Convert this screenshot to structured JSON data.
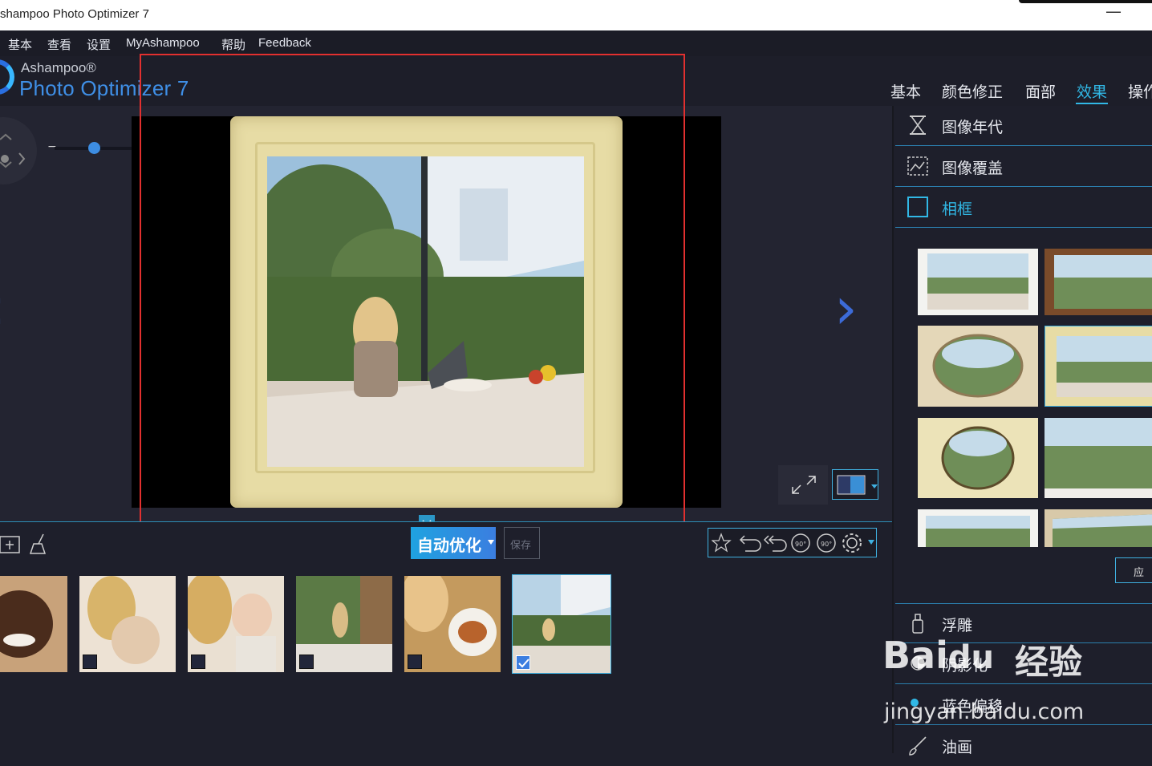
{
  "window": {
    "title": "shampoo Photo Optimizer 7",
    "minimize_glyph": "—"
  },
  "menu": [
    "基本",
    "查看",
    "设置",
    "MyAshampoo",
    "帮助",
    "Feedback"
  ],
  "logo": {
    "brand": "Ashampoo®",
    "product": "Photo Optimizer 7"
  },
  "tabs": [
    {
      "label": "基本",
      "active": false
    },
    {
      "label": "颜色修正",
      "active": false
    },
    {
      "label": "面部",
      "active": false
    },
    {
      "label": "效果",
      "active": true
    },
    {
      "label": "操作",
      "active": false
    }
  ],
  "zoom": {
    "minus": "−",
    "plus": "+",
    "level": 0.35
  },
  "toolbar": {
    "auto_optimize_label": "自动优化",
    "save_label": "保存",
    "tool_icons": [
      "magic-stars-icon",
      "undo-icon",
      "undo-all-icon",
      "rotate-left-90-icon",
      "rotate-right-90-icon",
      "settings-icon"
    ],
    "rotate_left_text": "90°",
    "rotate_right_text": "90°"
  },
  "filmstrip": [
    {
      "name": "boy-portrait",
      "checked": false
    },
    {
      "name": "mother-baby-1",
      "checked": false
    },
    {
      "name": "mother-baby-2",
      "checked": false
    },
    {
      "name": "kitchen-family",
      "checked": false
    },
    {
      "name": "breakfast-table",
      "checked": false
    },
    {
      "name": "woman-laptop",
      "checked": true
    }
  ],
  "effects_panel": {
    "sections_top": [
      {
        "label": "图像年代",
        "icon": "hourglass-icon",
        "active": false
      },
      {
        "label": "图像覆盖",
        "icon": "overlay-icon",
        "active": false
      },
      {
        "label": "相框",
        "icon": "frame-icon",
        "active": true
      }
    ],
    "frames": [
      "white-wave-frame",
      "wooden-frame",
      "oval-ornate-frame",
      "canvas-frame",
      "oval-gold-frame",
      "torn-edge-frame",
      "perspective-frame-1",
      "perspective-frame-2"
    ],
    "selected_frame_index": 3,
    "apply_label": "应",
    "sections_bottom": [
      {
        "label": "浮雕",
        "icon": "emboss-icon"
      },
      {
        "label": "阴影化",
        "icon": "shadow-icon"
      },
      {
        "label": "蓝色偏移",
        "icon": "blue-shift-icon"
      },
      {
        "label": "油画",
        "icon": "brush-icon"
      }
    ]
  },
  "watermark": {
    "brand": "Bai",
    "paw": "du",
    "product": "经验",
    "url": "jingyan.baidu.com"
  },
  "colors": {
    "accent": "#31b8e6",
    "background": "#1e1f2b",
    "annotation": "#e2302f"
  }
}
